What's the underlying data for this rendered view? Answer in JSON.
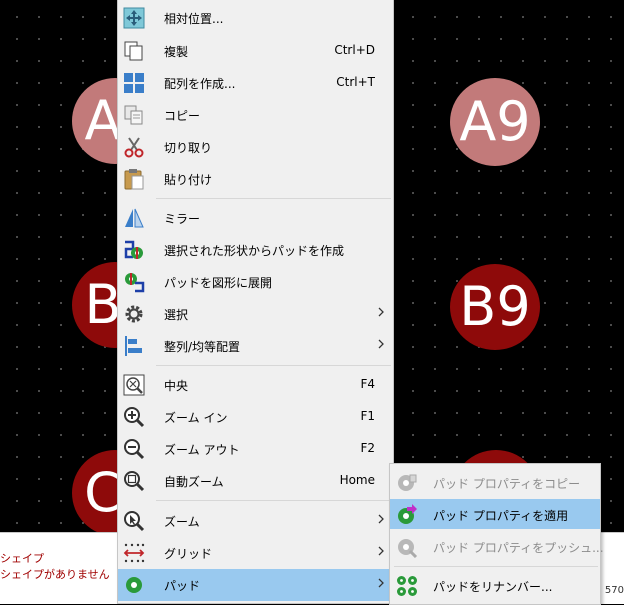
{
  "pads": [
    {
      "id": "a1",
      "label": "A",
      "color": "#c27a7a"
    },
    {
      "id": "a9",
      "label": "A9",
      "color": "#c27a7a"
    },
    {
      "id": "b1",
      "label": "B",
      "color": "#8e0a0a"
    },
    {
      "id": "b9",
      "label": "B9",
      "color": "#8e0a0a"
    },
    {
      "id": "c1",
      "label": "C",
      "color": "#8e0a0a"
    },
    {
      "id": "c9",
      "label": "",
      "color": "#8e0a0a"
    }
  ],
  "status": {
    "line1": "シェイプ",
    "line2": "シェイプがありません",
    "coord": "570"
  },
  "context_menu": {
    "move_relative": "相対位置...",
    "duplicate": "複製",
    "duplicate_shortcut": "Ctrl+D",
    "create_array": "配列を作成...",
    "create_array_shortcut": "Ctrl+T",
    "copy": "コピー",
    "cut": "切り取り",
    "paste": "貼り付け",
    "mirror": "ミラー",
    "pad_from_shapes": "選択された形状からパッドを作成",
    "explode_pad": "パッドを図形に展開",
    "select": "選択",
    "align_distribute": "整列/均等配置",
    "center": "中央",
    "center_shortcut": "F4",
    "zoom_in": "ズーム イン",
    "zoom_in_shortcut": "F1",
    "zoom_out": "ズーム アウト",
    "zoom_out_shortcut": "F2",
    "zoom_auto": "自動ズーム",
    "zoom_auto_shortcut": "Home",
    "zoom": "ズーム",
    "grid": "グリッド",
    "pad": "パッド"
  },
  "pad_submenu": {
    "copy_props": "パッド プロパティをコピー",
    "apply_props": "パッド プロパティを適用",
    "push_props": "パッド プロパティをプッシュ...",
    "renumber": "パッドをリナンバー..."
  },
  "colors": {
    "highlight": "#99c9ef",
    "menu_bg": "#f0f0f0",
    "pad_light": "#c27a7a",
    "pad_dark": "#8e0a0a"
  }
}
